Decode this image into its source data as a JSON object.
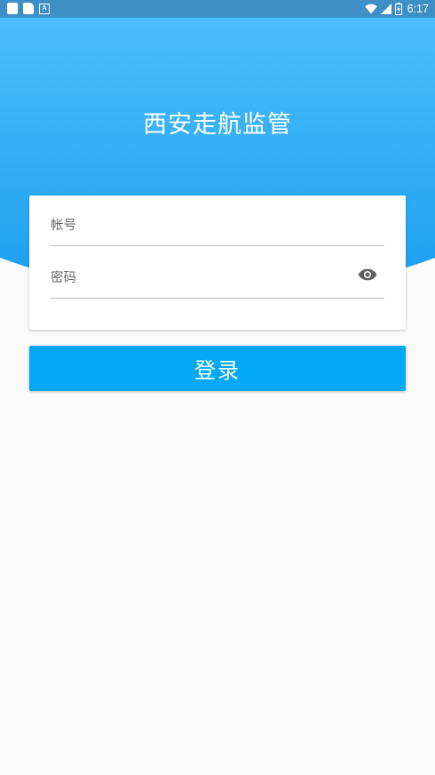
{
  "status_bar": {
    "left_icons": [
      "square-notification-icon",
      "sim-card-icon",
      "a-notification-icon"
    ],
    "right_icons": [
      "wifi-icon",
      "cell-signal-icon",
      "battery-charging-icon"
    ],
    "time": "6:17",
    "a_icon_glyph": "A"
  },
  "app": {
    "title": "西安走航监管"
  },
  "login": {
    "account_placeholder": "帐号",
    "password_placeholder": "密码",
    "password_toggle_icon": "eye-icon",
    "submit_label": "登录"
  },
  "colors": {
    "header_top": "#4dbdfb",
    "header_bottom": "#1a9ff0",
    "status_bar": "#3d8fc6",
    "button": "#03a9f4",
    "background": "#fafafa"
  }
}
